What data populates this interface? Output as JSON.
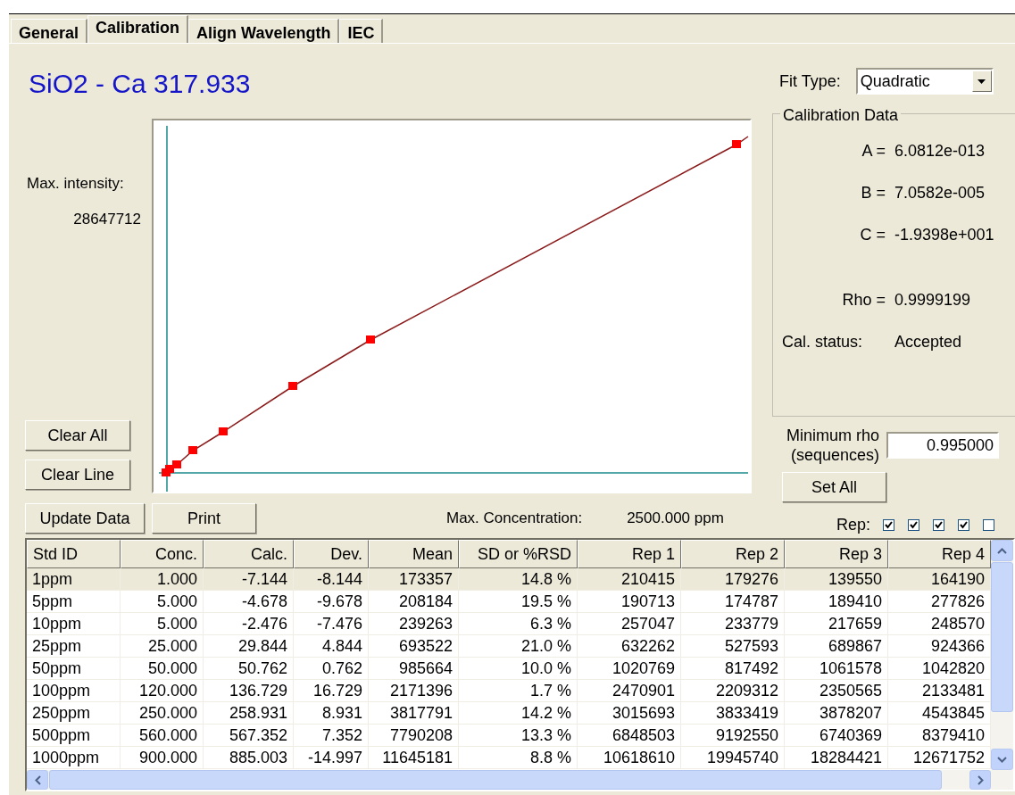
{
  "tabs": [
    {
      "label": "General",
      "selected": false
    },
    {
      "label": "Calibration",
      "selected": true
    },
    {
      "label": "Align Wavelength",
      "selected": false
    },
    {
      "label": "IEC",
      "selected": false
    }
  ],
  "title": "SiO2 - Ca 317.933",
  "fit_type": {
    "label": "Fit Type:",
    "value": "Quadratic"
  },
  "max_intensity": {
    "label": "Max. intensity:",
    "value": "28647712"
  },
  "chart_buttons": [
    "Clear All",
    "Clear Line"
  ],
  "data_buttons": [
    "Update Data",
    "Print"
  ],
  "max_concentration": {
    "label": "Max. Concentration:",
    "value": "2500.000 ppm"
  },
  "calibration_data": {
    "title": "Calibration Data",
    "rows": [
      {
        "label": "A =",
        "value": "6.0812e-013"
      },
      {
        "label": "B =",
        "value": "7.0582e-005"
      },
      {
        "label": "C =",
        "value": "-1.9398e+001"
      },
      {
        "label": "Rho =",
        "value": "0.9999199"
      },
      {
        "label": "Cal. status:",
        "value": "Accepted"
      }
    ]
  },
  "minimum_rho": {
    "label_lines": [
      "Minimum rho",
      "(sequences)"
    ],
    "value": "0.995000"
  },
  "set_all_button": "Set All",
  "rep": {
    "label": "Rep:",
    "checkboxes": [
      {
        "checked": true
      },
      {
        "checked": true
      },
      {
        "checked": true
      },
      {
        "checked": true
      },
      {
        "checked": false
      }
    ]
  },
  "table": {
    "columns": [
      "Std ID",
      "Conc.",
      "Calc.",
      "Dev.",
      "Mean",
      "SD or %RSD",
      "Rep 1",
      "Rep 2",
      "Rep 3",
      "Rep 4"
    ],
    "rows": [
      {
        "selected": true,
        "cells": [
          "1ppm",
          "1.000",
          "-7.144",
          "-8.144",
          "173357",
          "14.8 %",
          "210415",
          "179276",
          "139550",
          "164190"
        ]
      },
      {
        "selected": false,
        "cells": [
          "5ppm",
          "5.000",
          "-4.678",
          "-9.678",
          "208184",
          "19.5 %",
          "190713",
          "174787",
          "189410",
          "277826"
        ]
      },
      {
        "selected": false,
        "cells": [
          "10ppm",
          "5.000",
          "-2.476",
          "-7.476",
          "239263",
          "6.3 %",
          "257047",
          "233779",
          "217659",
          "248570"
        ]
      },
      {
        "selected": false,
        "cells": [
          "25ppm",
          "25.000",
          "29.844",
          "4.844",
          "693522",
          "21.0 %",
          "632262",
          "527593",
          "689867",
          "924366"
        ]
      },
      {
        "selected": false,
        "cells": [
          "50ppm",
          "50.000",
          "50.762",
          "0.762",
          "985664",
          "10.0 %",
          "1020769",
          "817492",
          "1061578",
          "1042820"
        ]
      },
      {
        "selected": false,
        "cells": [
          "100ppm",
          "120.000",
          "136.729",
          "16.729",
          "2171396",
          "1.7 %",
          "2470901",
          "2209312",
          "2350565",
          "2133481"
        ]
      },
      {
        "selected": false,
        "cells": [
          "250ppm",
          "250.000",
          "258.931",
          "8.931",
          "3817791",
          "14.2 %",
          "3015693",
          "3833419",
          "3878207",
          "4543845"
        ]
      },
      {
        "selected": false,
        "cells": [
          "500ppm",
          "560.000",
          "567.352",
          "7.352",
          "7790208",
          "13.3 %",
          "6848503",
          "9192550",
          "6740369",
          "8379410"
        ]
      },
      {
        "selected": false,
        "cells": [
          "1000ppm",
          "900.000",
          "885.003",
          "-14.997",
          "11645181",
          "8.8 %",
          "10618610",
          "19945740",
          "18284421",
          "12671752"
        ]
      }
    ]
  }
}
